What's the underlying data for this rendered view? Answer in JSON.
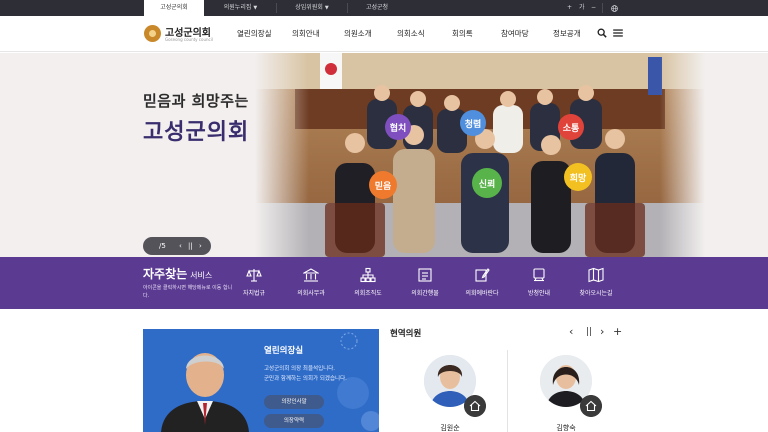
{
  "top_nav": {
    "tabs": [
      {
        "label": "고성군의회",
        "active": true
      },
      {
        "label": "의원누리집",
        "has_menu": true
      },
      {
        "label": "상임위원회",
        "has_menu": true
      },
      {
        "label": "고성군청"
      }
    ],
    "font_plus": "+",
    "font_label": "가",
    "font_minus": "−",
    "globe_icon": "globe-icon"
  },
  "header": {
    "logo_name": "고성군의회",
    "logo_sub": "Goseong county council",
    "menu": [
      "열린의장실",
      "의회안내",
      "의원소개",
      "의회소식",
      "회의록",
      "참여마당",
      "정보공개"
    ],
    "search_icon": "search-icon",
    "menu_icon": "hamburger-menu-icon"
  },
  "hero": {
    "tagline_line1": "믿음과 희망주는",
    "tagline_line2": "고성군의회",
    "pager_count": "/5",
    "prev": "‹",
    "pause": "||",
    "next": "›",
    "photo_signs": [
      "협치",
      "청렴",
      "소통",
      "믿음",
      "신뢰",
      "희망"
    ]
  },
  "service": {
    "title_bold": "자주찾는",
    "title_rest": "서비스",
    "description": "아이콘을 클릭하시면 해당메뉴로 이동 합니다.",
    "items": [
      {
        "label": "자치법규",
        "icon": "scales-icon"
      },
      {
        "label": "의회사무과",
        "icon": "building-icon"
      },
      {
        "label": "의회조직도",
        "icon": "org-chart-icon"
      },
      {
        "label": "의회간행물",
        "icon": "publication-icon"
      },
      {
        "label": "의회에바란다",
        "icon": "edit-icon"
      },
      {
        "label": "방청안내",
        "icon": "gallery-icon"
      },
      {
        "label": "찾아오시는길",
        "icon": "map-icon"
      }
    ]
  },
  "speaker_room": {
    "heading": "열린의장실",
    "text_line1": "고성군의회 의장 최을석입니다.",
    "text_line2": "군민과 함께하는 의회가 되겠습니다.",
    "button1": "의장인사말",
    "button2": "의장약력"
  },
  "members": {
    "title": "현역의원",
    "prev": "‹",
    "pause": "||",
    "next": "›",
    "more": "+",
    "list": [
      {
        "name": "김원순"
      },
      {
        "name": "김향숙"
      }
    ]
  },
  "colors": {
    "topbar": "#2e2e36",
    "service_band": "#5b3a91",
    "speaker_box": "#2f6cc8",
    "brand_gold": "#c9892a"
  }
}
